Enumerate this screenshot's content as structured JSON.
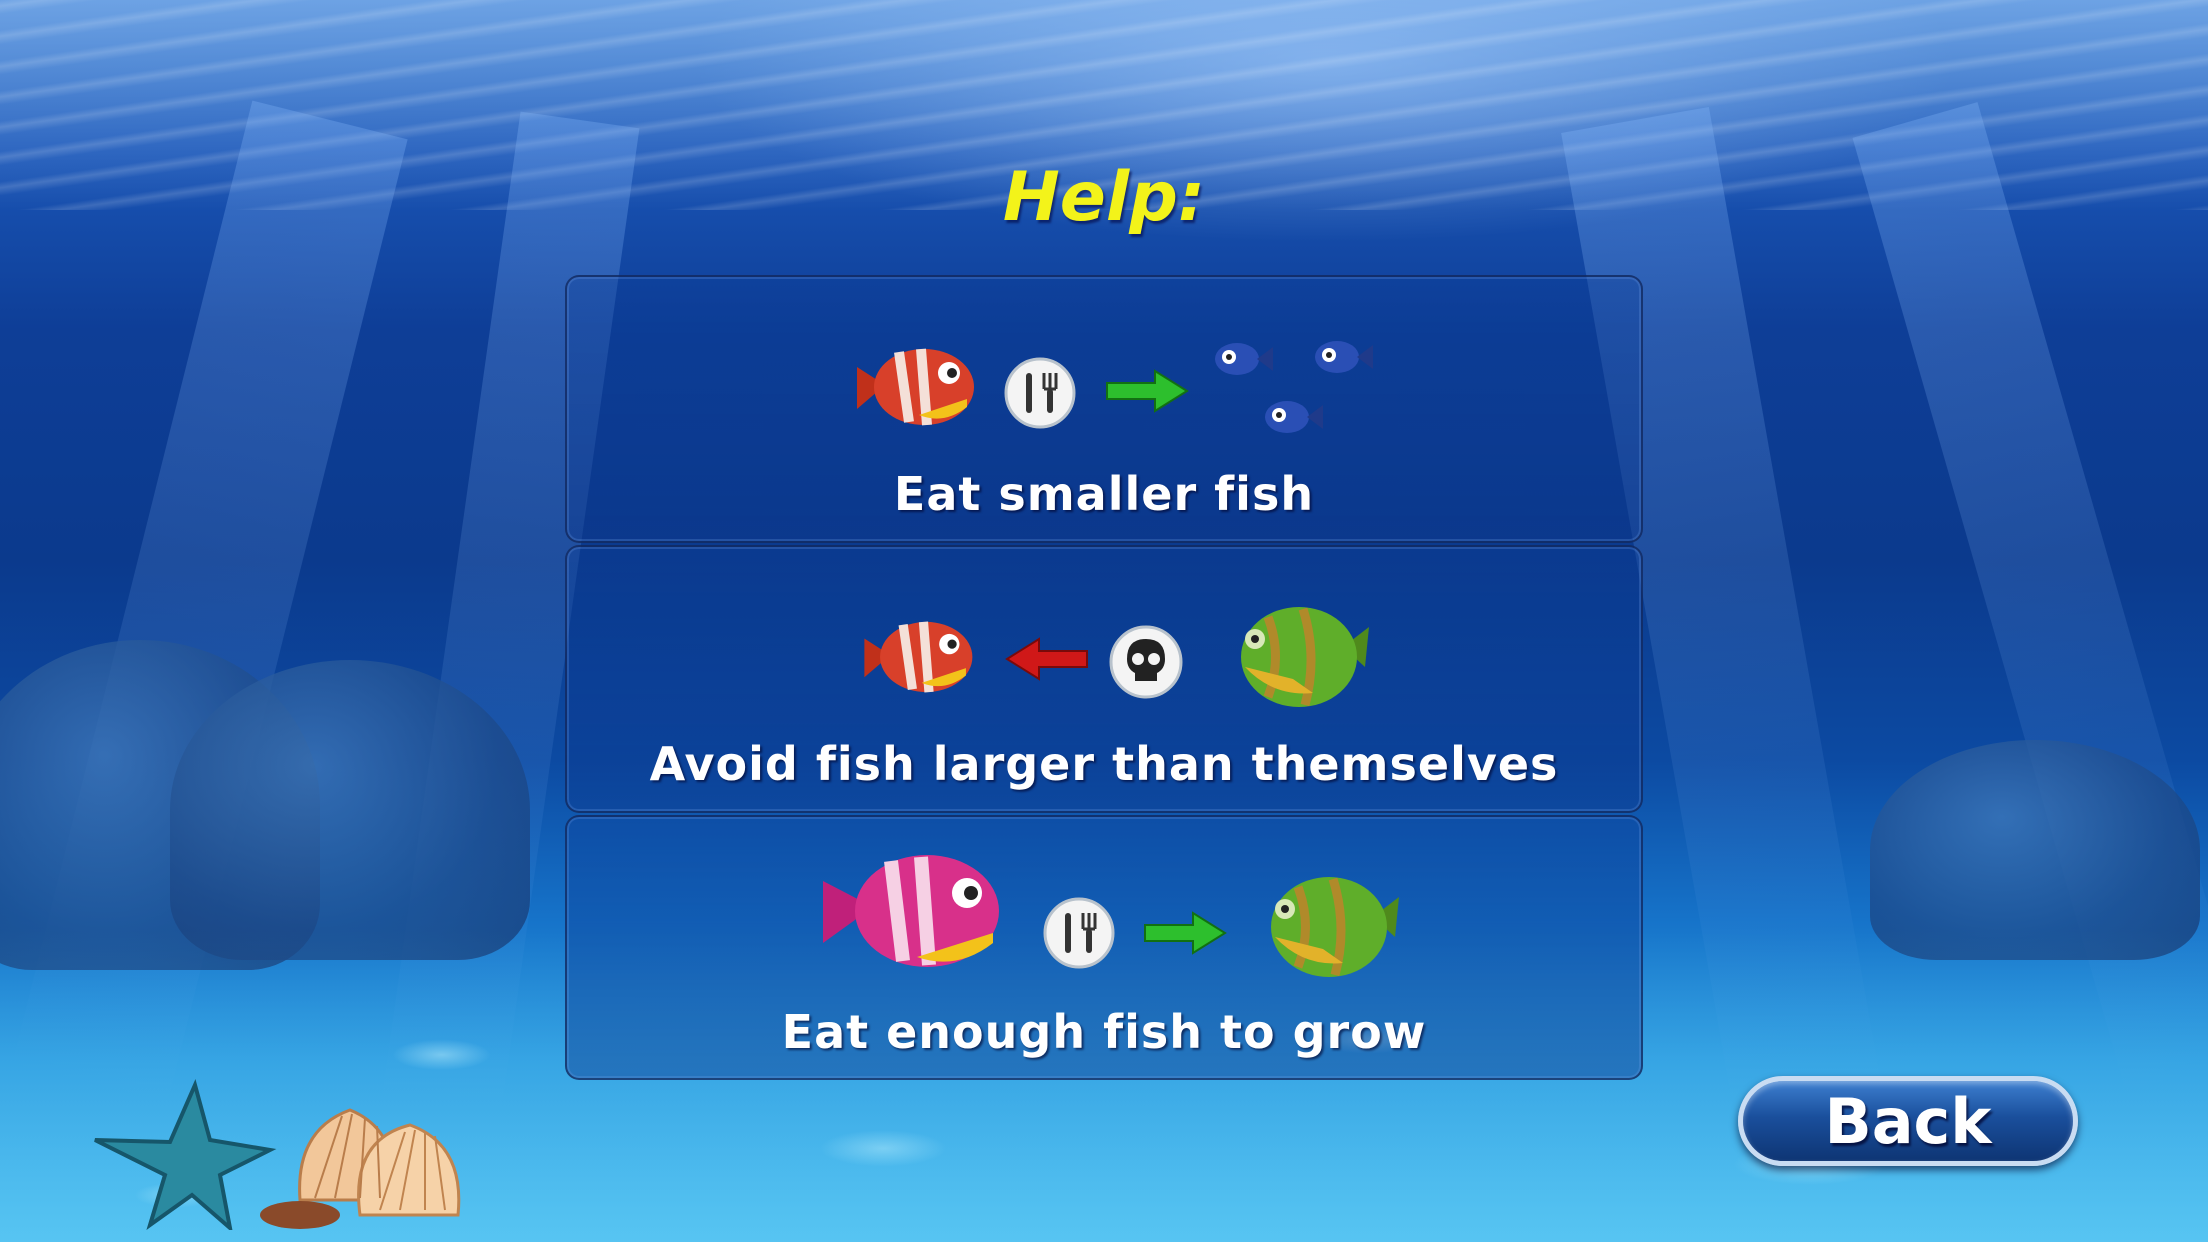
{
  "screen": {
    "title": "Help:",
    "colors": {
      "title": "#f3f31a",
      "label": "#ffffff"
    }
  },
  "tips": [
    {
      "label": "Eat smaller fish",
      "icons": [
        "red-fish-icon",
        "fork-knife-icon",
        "green-arrow-icon",
        "small-blue-fish-icon"
      ]
    },
    {
      "label": "Avoid fish larger than themselves",
      "icons": [
        "red-fish-icon",
        "red-arrow-icon",
        "skull-icon",
        "green-fish-icon"
      ]
    },
    {
      "label": "Eat enough fish to grow",
      "icons": [
        "pink-fish-icon",
        "fork-knife-icon",
        "green-arrow-icon",
        "green-fish-icon"
      ]
    }
  ],
  "back_button": {
    "label": "Back"
  }
}
